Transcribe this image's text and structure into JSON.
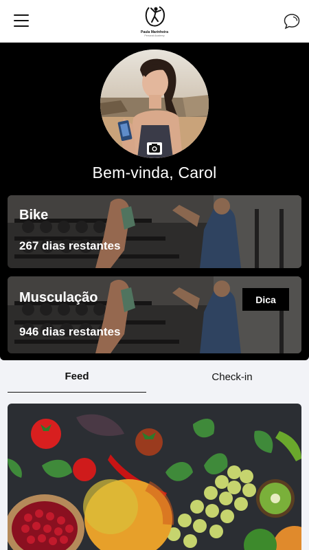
{
  "header": {
    "menu_icon": "hamburger-menu-icon",
    "logo_name": "Paula Marinheira",
    "logo_tagline": "Personal Academy",
    "chat_icon": "chat-bubble-icon"
  },
  "profile": {
    "welcome_text": "Bem-vinda, Carol",
    "camera_icon": "camera-icon"
  },
  "plans": [
    {
      "title": "Bike",
      "remaining": "267 dias restantes"
    },
    {
      "title": "Musculação",
      "remaining": "946 dias restantes",
      "tip_label": "Dica"
    }
  ],
  "tabs": {
    "feed": "Feed",
    "checkin": "Check-in",
    "active": "Feed"
  },
  "colors": {
    "hero_bg": "#000000",
    "page_bg": "#f2f3f7",
    "header_bg": "#ffffff"
  }
}
